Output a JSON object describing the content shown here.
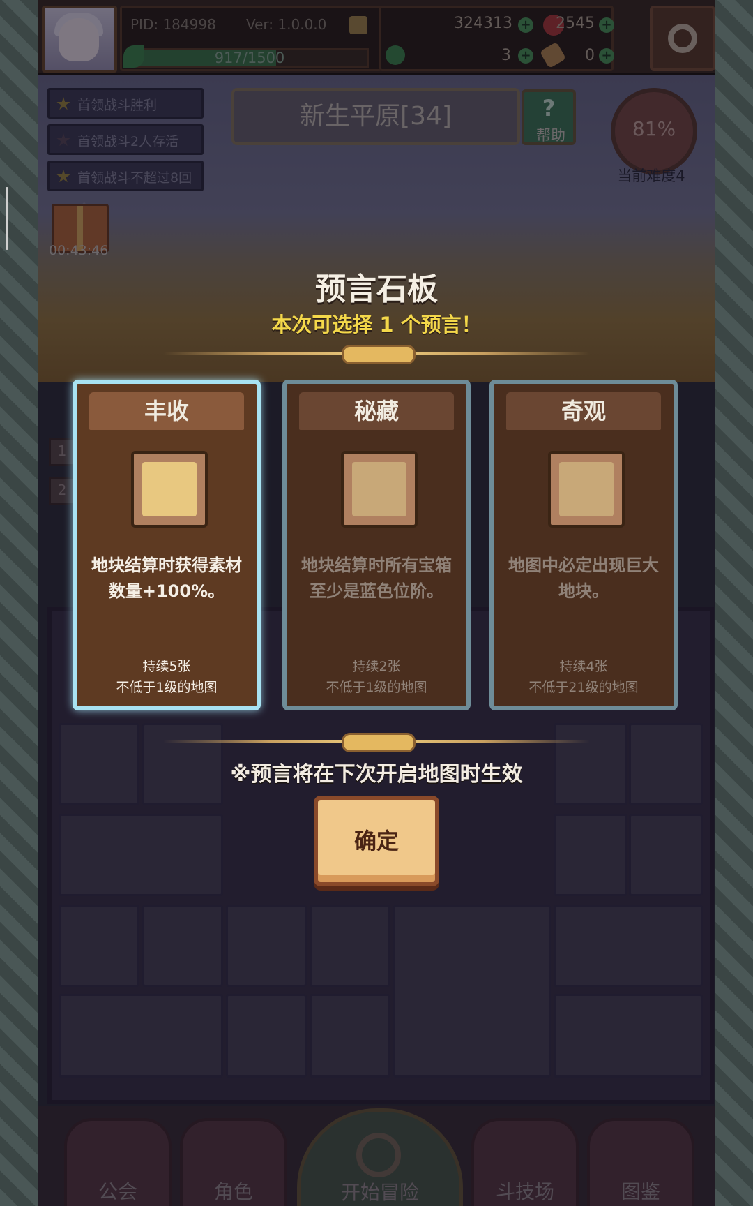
{
  "player": {
    "pid": "PID: 184998",
    "version": "Ver: 1.0.0.0",
    "xp_text": "917/1500",
    "xp_fraction": 0.611
  },
  "resources": {
    "coins": "324313",
    "red_gems": "2545",
    "clovers": "3",
    "scrolls": "0"
  },
  "quests": [
    {
      "label": "首领战斗胜利",
      "done": true
    },
    {
      "label": "首领战斗2人存活",
      "done": false
    },
    {
      "label": "首领战斗不超过8回合",
      "done": true
    }
  ],
  "region": {
    "name": "新生平原[34]",
    "help_label": "帮助",
    "help_symbol": "?"
  },
  "difficulty": {
    "percent": "81%",
    "label": "当前难度4"
  },
  "gift": {
    "timer": "00:43:46"
  },
  "modal": {
    "title": "预言石板",
    "subtitle": "本次可选择 1 个预言！",
    "cards": [
      {
        "name": "丰收",
        "desc": "地块结算时获得素材数量+100%。",
        "duration": "持续5张",
        "requirement": "不低于1级的地图",
        "icon": "harvest-icon",
        "selected": true
      },
      {
        "name": "秘藏",
        "desc": "地块结算时所有宝箱至少是蓝色位阶。",
        "duration": "持续2张",
        "requirement": "不低于1级的地图",
        "icon": "treasure-scroll-icon",
        "selected": false
      },
      {
        "name": "奇观",
        "desc": "地图中必定出现巨大地块。",
        "duration": "持续4张",
        "requirement": "不低于21级的地图",
        "icon": "signpost-icon",
        "selected": false
      }
    ],
    "note": "※预言将在下次开启地图时生效",
    "confirm_label": "确定"
  },
  "board_badges": [
    "1",
    "2"
  ],
  "nav": [
    {
      "label": "公会"
    },
    {
      "label": "角色"
    },
    {
      "label": "开始冒险"
    },
    {
      "label": "斗技场"
    },
    {
      "label": "图鉴"
    }
  ],
  "colors": {
    "accent_gold": "#f4d84a",
    "selected_border": "#a8e2f2",
    "card_bg": "#4a2e1e",
    "confirm_bg": "#f0c88a"
  }
}
